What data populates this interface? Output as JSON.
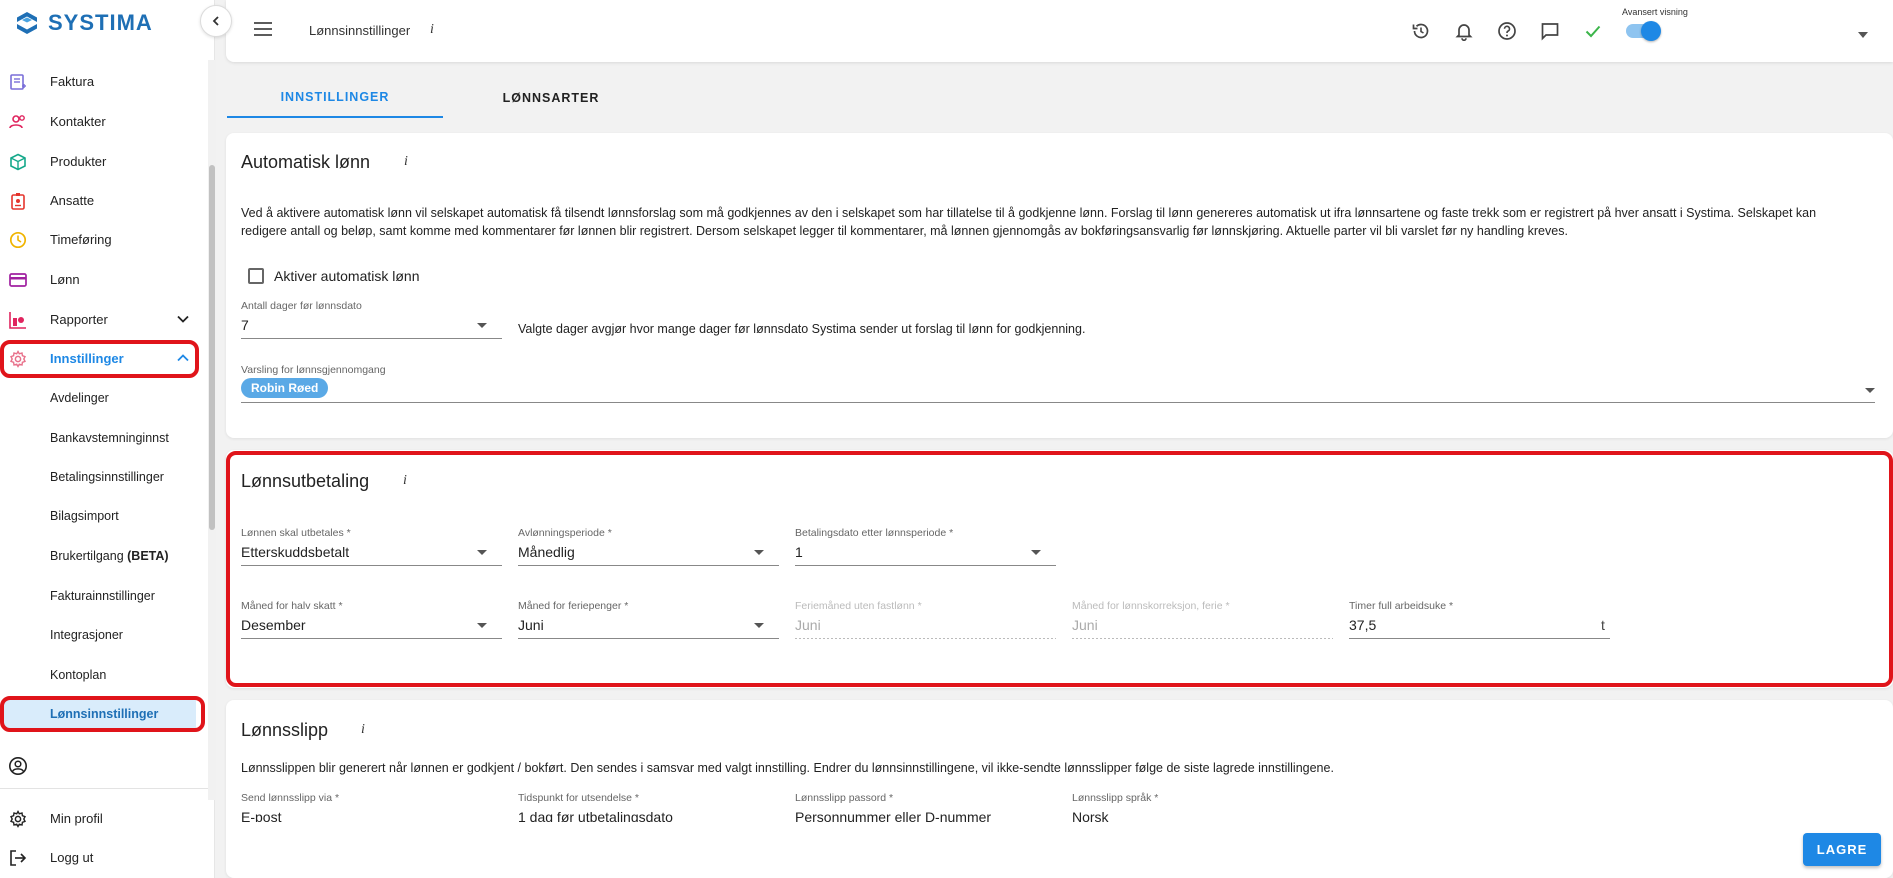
{
  "app": {
    "brand": "SYSTIMA"
  },
  "sidebar": {
    "items": [
      {
        "label": "Faktura"
      },
      {
        "label": "Kontakter"
      },
      {
        "label": "Produkter"
      },
      {
        "label": "Ansatte"
      },
      {
        "label": "Timeføring"
      },
      {
        "label": "Lønn"
      },
      {
        "label": "Rapporter"
      },
      {
        "label": "Innstillinger"
      }
    ],
    "sub_items": [
      {
        "label": "Avdelinger"
      },
      {
        "label": "Bankavstemninginnst"
      },
      {
        "label": "Betalingsinnstillinger"
      },
      {
        "label": "Bilagsimport"
      },
      {
        "label": "Brukertilgang",
        "suffix": "(BETA)"
      },
      {
        "label": "Fakturainnstillinger"
      },
      {
        "label": "Integrasjoner"
      },
      {
        "label": "Kontoplan"
      },
      {
        "label": "Lønnsinnstillinger"
      }
    ],
    "bottom_items": [
      {
        "label": "Min profil"
      },
      {
        "label": "Logg ut"
      }
    ]
  },
  "header": {
    "title": "Lønnsinnstillinger",
    "info": "i",
    "advanced_label": "Avansert visning",
    "advanced_on": true
  },
  "tabs": [
    {
      "label": "INNSTILLINGER",
      "active": true
    },
    {
      "label": "LØNNSARTER",
      "active": false
    }
  ],
  "auto": {
    "title": "Automatisk lønn",
    "info": "i",
    "description_line1": "Ved å aktivere automatisk lønn vil selskapet automatisk få tilsendt lønnsforslag som må godkjennes av den i selskapet som har tillatelse til å godkjenne lønn. Forslag til lønn genereres automatisk ut ifra lønnsartene og faste trekk som er registrert på hver ansatt i Systima. Selskapet kan",
    "description_line2": "redigere antall og beløp, samt komme med kommentarer før lønnen blir registrert. Dersom selskapet legger til kommentarer, må lønnen gjennomgås av bokføringsansvarlig før lønnskjøring. Aktuelle parter vil bli varslet før ny handling kreves.",
    "checkbox_label": "Aktiver automatisk lønn",
    "days_label": "Antall dager før lønnsdato",
    "days_value": "7",
    "days_hint": "Valgte dager avgjør hvor mange dager før lønnsdato Systima sender ut forslag til lønn for godkjenning.",
    "notify_label": "Varsling for lønnsgjennomgang",
    "notify_chip": "Robin Røed"
  },
  "payout": {
    "title": "Lønnsutbetaling",
    "info": "i",
    "paid_label": "Lønnen skal utbetales *",
    "paid_value": "Etterskuddsbetalt",
    "period_label": "Avlønningsperiode *",
    "period_value": "Månedlig",
    "paydate_label": "Betalingsdato etter lønnsperiode *",
    "paydate_value": "1",
    "halftax_label": "Måned for halv skatt *",
    "halftax_value": "Desember",
    "holiday_label": "Måned for feriepenger *",
    "holiday_value": "Juni",
    "holiday_nofixed_label": "Feriemåned uten fastlønn *",
    "holiday_nofixed_value": "Juni",
    "correction_label": "Måned for lønnskorreksjon, ferie *",
    "correction_value": "Juni",
    "hours_label": "Timer full arbeidsuke *",
    "hours_value": "37,5",
    "hours_suffix": "t"
  },
  "slip": {
    "title": "Lønnsslipp",
    "info": "i",
    "description": "Lønnsslippen blir generert når lønnen er godkjent / bokført. Den sendes i samsvar med valgt innstilling. Endrer du lønnsinnstillingene, vil ikke-sendte lønnsslipper følge de siste lagrede innstillingene.",
    "send_label": "Send lønnsslipp via *",
    "send_value": "E-post",
    "time_label": "Tidspunkt for utsendelse *",
    "time_value": "1 dag før utbetalingsdato",
    "password_label": "Lønnsslipp passord *",
    "password_value": "Personnummer eller D-nummer",
    "language_label": "Lønnsslipp språk *",
    "language_value": "Norsk"
  },
  "actions": {
    "save": "LAGRE"
  },
  "colors": {
    "accent": "#1e88e5",
    "highlight": "#e0141a",
    "active_bg": "#d9ecfb"
  }
}
